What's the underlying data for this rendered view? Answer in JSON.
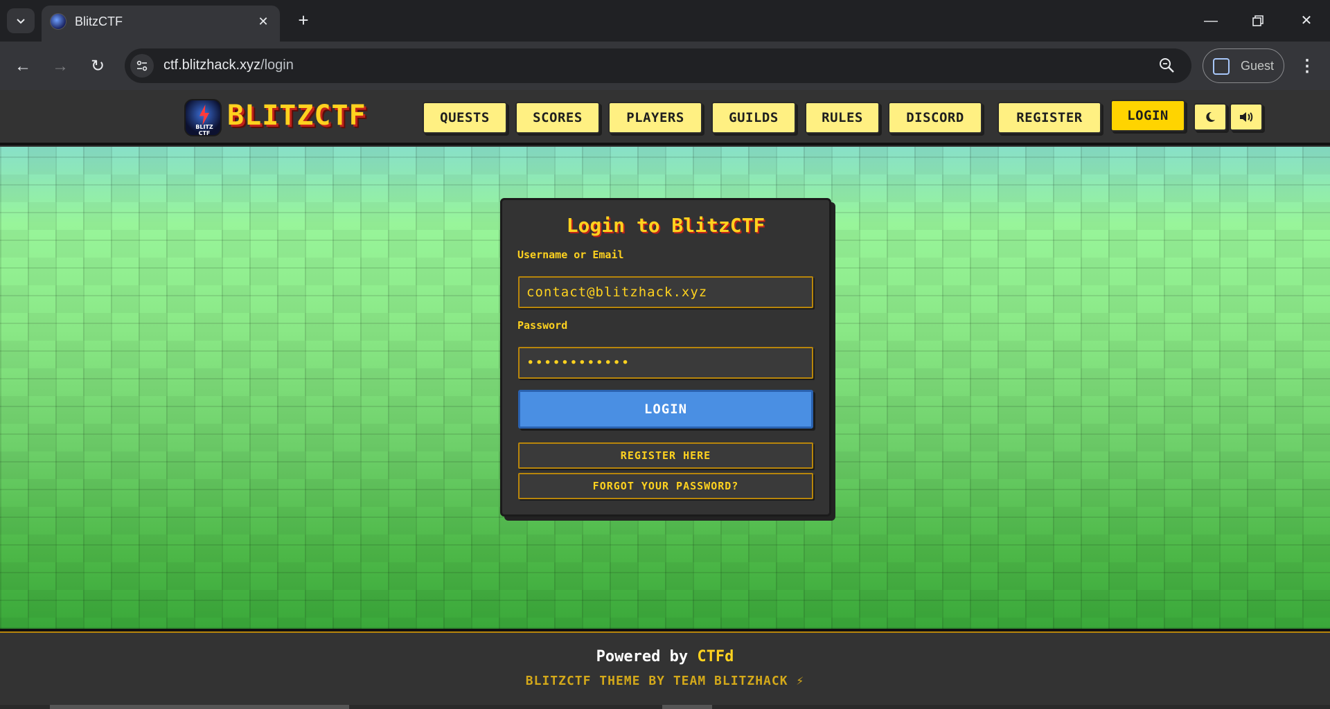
{
  "browser": {
    "tab_title": "BlitzCTF",
    "url_host": "ctf.blitzhack.xyz",
    "url_path": "/login",
    "profile_label": "Guest"
  },
  "site": {
    "logo_text": "BLITZCTF",
    "logo_image_caption": "BLITZ CTF",
    "nav": {
      "quests": "QUESTS",
      "scores": "SCORES",
      "players": "PLAYERS",
      "guilds": "GUILDS",
      "rules": "RULES",
      "discord": "DISCORD",
      "register": "REGISTER",
      "login": "LOGIN"
    },
    "icons": {
      "theme": "moon-icon",
      "sound": "speaker-icon"
    }
  },
  "login_card": {
    "title": "Login to BlitzCTF",
    "username_label": "Username or Email",
    "username_value": "contact@blitzhack.xyz",
    "password_label": "Password",
    "password_value": "••••••••••••",
    "login_button": "LOGIN",
    "register_link": "REGISTER HERE",
    "forgot_link": "FORGOT YOUR PASSWORD?"
  },
  "footer": {
    "powered_prefix": "Powered by",
    "powered_brand": "CTFd",
    "theme_credit": "BLITZCTF THEME BY TEAM BLITZHACK ⚡"
  },
  "colors": {
    "accent_yellow": "#ffd21f",
    "nav_button": "#fff082",
    "login_blue": "#4a8fe3",
    "panel": "#333333"
  }
}
